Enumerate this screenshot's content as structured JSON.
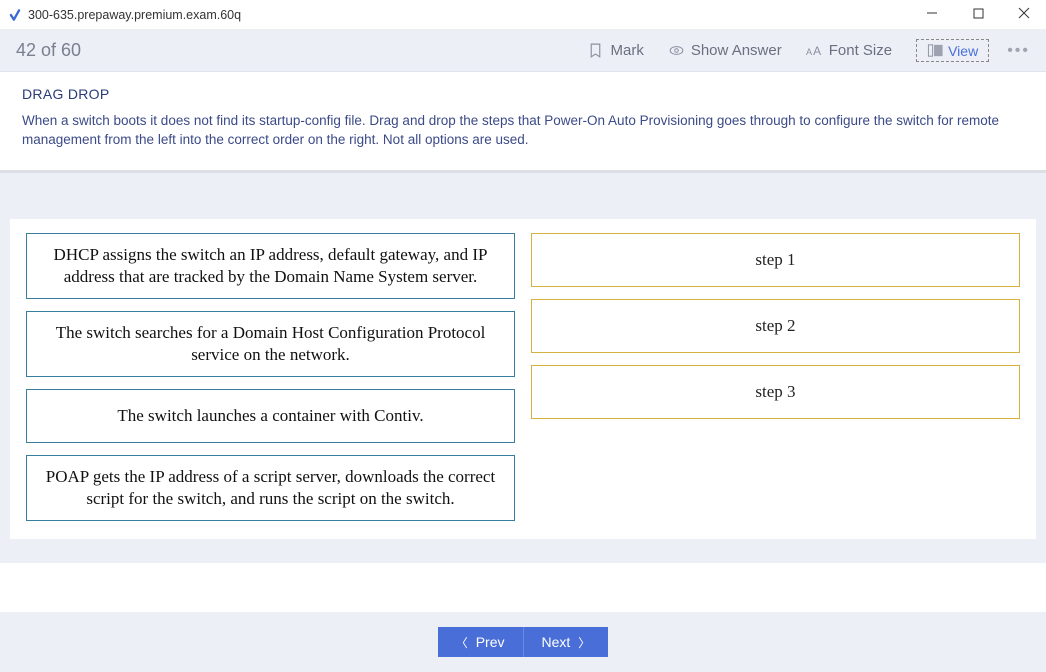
{
  "window": {
    "title": "300-635.prepaway.premium.exam.60q"
  },
  "toolbar": {
    "counter": "42 of 60",
    "mark": "Mark",
    "show_answer": "Show Answer",
    "font_size": "Font Size",
    "view": "View"
  },
  "question": {
    "heading": "DRAG DROP",
    "text": "When a switch boots it does not find its startup-config file. Drag and drop the steps that Power-On Auto Provisioning goes through to configure the switch for remote management from the left into the correct order on the right. Not all options are used."
  },
  "sources": [
    "DHCP assigns the switch an IP address, default gateway, and IP address that are tracked by the Domain Name System server.",
    "The switch searches for a Domain Host Configuration Protocol service on the network.",
    "The switch launches a container with Contiv.",
    "POAP gets the IP address of a script server, downloads the correct script for the switch, and runs the script on the switch."
  ],
  "targets": [
    "step 1",
    "step 2",
    "step 3"
  ],
  "nav": {
    "prev": "Prev",
    "next": "Next"
  }
}
